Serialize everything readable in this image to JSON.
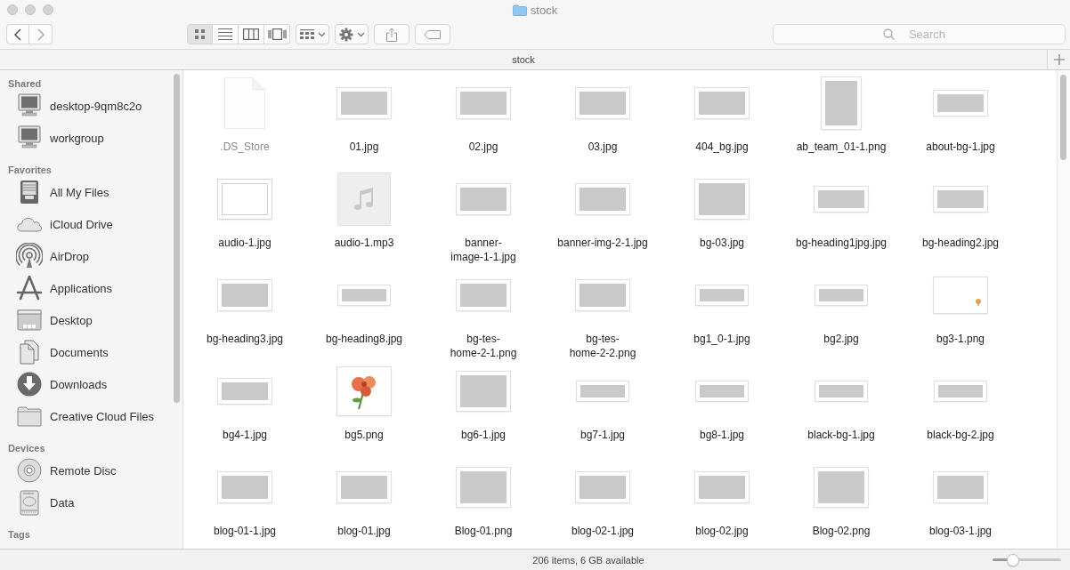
{
  "window": {
    "title": "stock"
  },
  "toolbar": {
    "view_modes": [
      {
        "kind": "icons",
        "selected": true
      },
      {
        "kind": "list",
        "selected": false
      },
      {
        "kind": "columns",
        "selected": false
      },
      {
        "kind": "coverflow",
        "selected": false
      }
    ]
  },
  "search": {
    "placeholder": "Search"
  },
  "tabs": [
    {
      "label": "stock"
    }
  ],
  "sidebar": {
    "sections": [
      {
        "heading": "Shared",
        "items": [
          {
            "label": "desktop-9qm8c2o",
            "kind": "computer"
          },
          {
            "label": "workgroup",
            "kind": "computer"
          }
        ]
      },
      {
        "heading": "Favorites",
        "items": [
          {
            "label": "All My Files",
            "kind": "inbox"
          },
          {
            "label": "iCloud Drive",
            "kind": "cloud"
          },
          {
            "label": "AirDrop",
            "kind": "airdrop"
          },
          {
            "label": "Applications",
            "kind": "apps"
          },
          {
            "label": "Desktop",
            "kind": "desktop"
          },
          {
            "label": "Documents",
            "kind": "documents"
          },
          {
            "label": "Downloads",
            "kind": "downloads"
          },
          {
            "label": "Creative Cloud Files",
            "kind": "folder"
          }
        ]
      },
      {
        "heading": "Devices",
        "items": [
          {
            "label": "Remote Disc",
            "kind": "disc"
          },
          {
            "label": "Data",
            "kind": "drive"
          }
        ]
      },
      {
        "heading": "Tags"
      }
    ]
  },
  "files": [
    {
      "name": ".DS_Store",
      "kind": "document",
      "hidden": true
    },
    {
      "name": "01.jpg",
      "kind": "landscape",
      "hidden": false
    },
    {
      "name": "02.jpg",
      "kind": "landscape",
      "hidden": false
    },
    {
      "name": "03.jpg",
      "kind": "landscape",
      "hidden": false
    },
    {
      "name": "404_bg.jpg",
      "kind": "landscape",
      "hidden": false
    },
    {
      "name": "ab_team_01-1.png",
      "kind": "portrait",
      "hidden": false
    },
    {
      "name": "about-bg-1.jpg",
      "kind": "banner",
      "hidden": false
    },
    {
      "name": "audio-1.jpg",
      "kind": "blank",
      "hidden": false
    },
    {
      "name": "audio-1.mp3",
      "kind": "audio",
      "hidden": false
    },
    {
      "name": "banner-\nimage-1-1.jpg",
      "kind": "landscape",
      "hidden": false
    },
    {
      "name": "banner-img-2-1.jpg",
      "kind": "landscape",
      "hidden": false
    },
    {
      "name": "bg-03.jpg",
      "kind": "square",
      "hidden": false
    },
    {
      "name": "bg-heading1jpg.jpg",
      "kind": "banner",
      "hidden": false
    },
    {
      "name": "bg-heading2.jpg",
      "kind": "banner",
      "hidden": false
    },
    {
      "name": "bg-heading3.jpg",
      "kind": "landscape",
      "hidden": false
    },
    {
      "name": "bg-heading8.jpg",
      "kind": "strip",
      "hidden": false
    },
    {
      "name": "bg-tes-\nhome-2-1.png",
      "kind": "landscape",
      "hidden": false
    },
    {
      "name": "bg-tes-\nhome-2-2.png",
      "kind": "landscape",
      "hidden": false
    },
    {
      "name": "bg1_0-1.jpg",
      "kind": "strip",
      "hidden": false
    },
    {
      "name": "bg2.jpg",
      "kind": "strip",
      "hidden": false
    },
    {
      "name": "bg3-1.png",
      "kind": "ornament",
      "hidden": false
    },
    {
      "name": "bg4-1.jpg",
      "kind": "banner",
      "hidden": false
    },
    {
      "name": "bg5.png",
      "kind": "photo",
      "hidden": false
    },
    {
      "name": "bg6-1.jpg",
      "kind": "square",
      "hidden": false
    },
    {
      "name": "bg7-1.jpg",
      "kind": "strip",
      "hidden": false
    },
    {
      "name": "bg8-1.jpg",
      "kind": "strip",
      "hidden": false
    },
    {
      "name": "black-bg-1.jpg",
      "kind": "strip",
      "hidden": false
    },
    {
      "name": "black-bg-2.jpg",
      "kind": "strip",
      "hidden": false
    },
    {
      "name": "blog-01-1.jpg",
      "kind": "landscape",
      "hidden": false
    },
    {
      "name": "blog-01.jpg",
      "kind": "landscape",
      "hidden": false
    },
    {
      "name": "Blog-01.png",
      "kind": "square",
      "hidden": false
    },
    {
      "name": "blog-02-1.jpg",
      "kind": "landscape",
      "hidden": false
    },
    {
      "name": "blog-02.jpg",
      "kind": "landscape",
      "hidden": false
    },
    {
      "name": "Blog-02.png",
      "kind": "square",
      "hidden": false
    },
    {
      "name": "blog-03-1.jpg",
      "kind": "landscape",
      "hidden": false
    }
  ],
  "status_bar": {
    "text": "206 items, 6 GB available",
    "icon_size": {
      "level": 0.26
    }
  }
}
